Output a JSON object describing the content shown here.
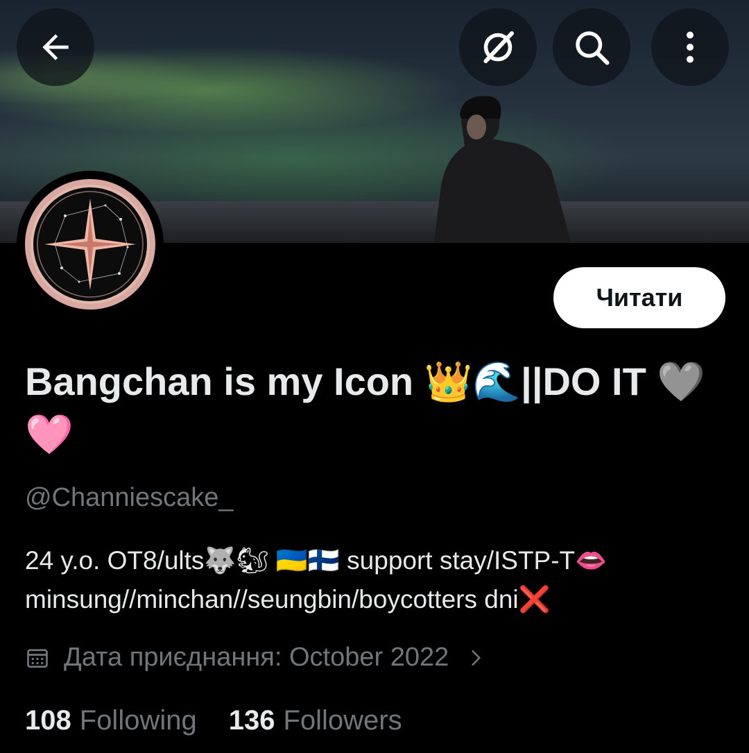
{
  "header": {
    "back_icon": "arrow-left-icon",
    "grok_icon": "slashed-circle-icon",
    "search_icon": "search-icon",
    "more_icon": "more-vertical-icon"
  },
  "profile": {
    "display_name": "Bangchan is my Icon 👑🌊||DO IT 🩶🩷",
    "handle": "@Channiescake_",
    "bio_line1": "24 y.o. OT8/ults🐺🐿 🇺🇦🇫🇮 support stay/ISTP-T👄",
    "bio_line2": "minsung//minchan//seungbin/boycotters dni❌",
    "joined": "Дата приєднання: October 2022",
    "following_count": "108",
    "following_label": "Following",
    "followers_count": "136",
    "followers_label": "Followers"
  },
  "actions": {
    "follow_label": "Читати"
  },
  "colors": {
    "background": "#000000",
    "primary_text": "#e7e9ea",
    "secondary_text": "#71767b",
    "follow_button_bg": "#ffffff"
  }
}
